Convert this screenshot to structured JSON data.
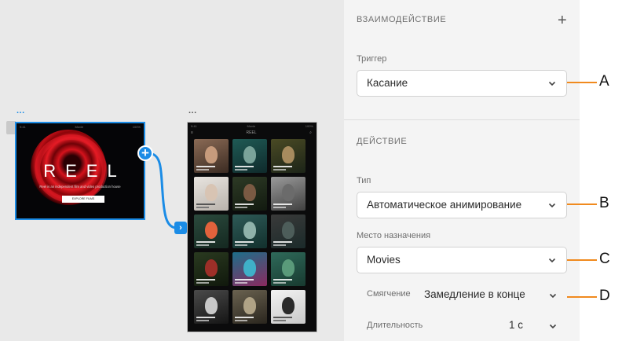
{
  "canvas": {
    "artboard_menu_dots": "...",
    "reel": {
      "status_left": "9:41",
      "status_center": "Movie",
      "status_right": "100%",
      "title": "REEL",
      "subtitle": "Reel is an independent film and video production house",
      "button_label": "EXPLORE FILMS"
    },
    "movies": {
      "status_left": "9:41",
      "status_center": "Movie",
      "status_right": "100%",
      "nav_left": "≡",
      "nav_center": "REEL",
      "nav_right": "⌕"
    }
  },
  "panel": {
    "interaction": {
      "title": "ВЗАИМОДЕЙСТВИЕ",
      "add_icon": "+",
      "trigger_label": "Триггер",
      "trigger_value": "Касание"
    },
    "action": {
      "title": "ДЕЙСТВИЕ",
      "type_label": "Тип",
      "type_value": "Автоматическое анимирование",
      "destination_label": "Место назначения",
      "destination_value": "Movies",
      "easing_label": "Смягчение",
      "easing_value": "Замедление в конце",
      "duration_label": "Длительность",
      "duration_value": "1 с"
    }
  },
  "callouts": [
    "A",
    "B",
    "C",
    "D"
  ],
  "colors": {
    "accent_blue": "#1b8ce6",
    "callout_orange": "#f08a1e",
    "reel_red": "#d5121c"
  },
  "icons": {
    "add": "plus-icon",
    "dropdown": "chevron-down-icon",
    "wire_start": "plus-circle-icon",
    "wire_end": "chevron-right-icon"
  }
}
